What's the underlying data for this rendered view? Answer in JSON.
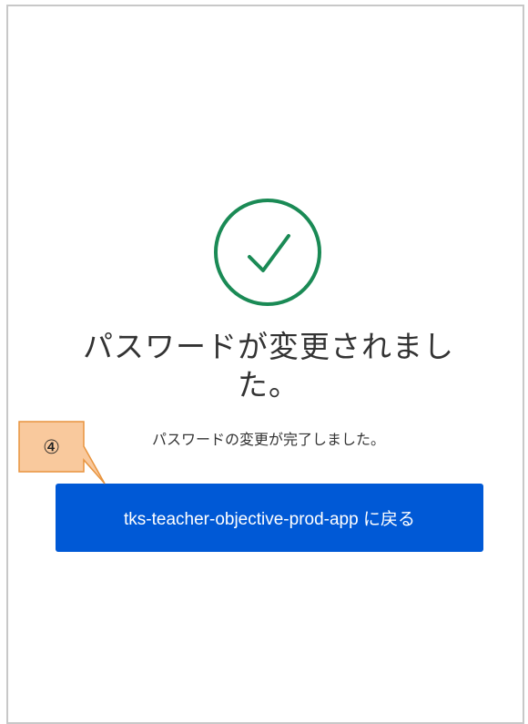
{
  "confirmation": {
    "title": "パスワードが変更されました。",
    "message": "パスワードの変更が完了しました。",
    "return_button_label": "tks-teacher-objective-prod-app に戻る",
    "icon": "checkmark-circle-icon",
    "success_color": "#1a8a55",
    "button_color": "#0059d6"
  },
  "annotation": {
    "callout_number": "④",
    "callout_fill": "#f9c99d",
    "callout_border": "#e8943e"
  }
}
